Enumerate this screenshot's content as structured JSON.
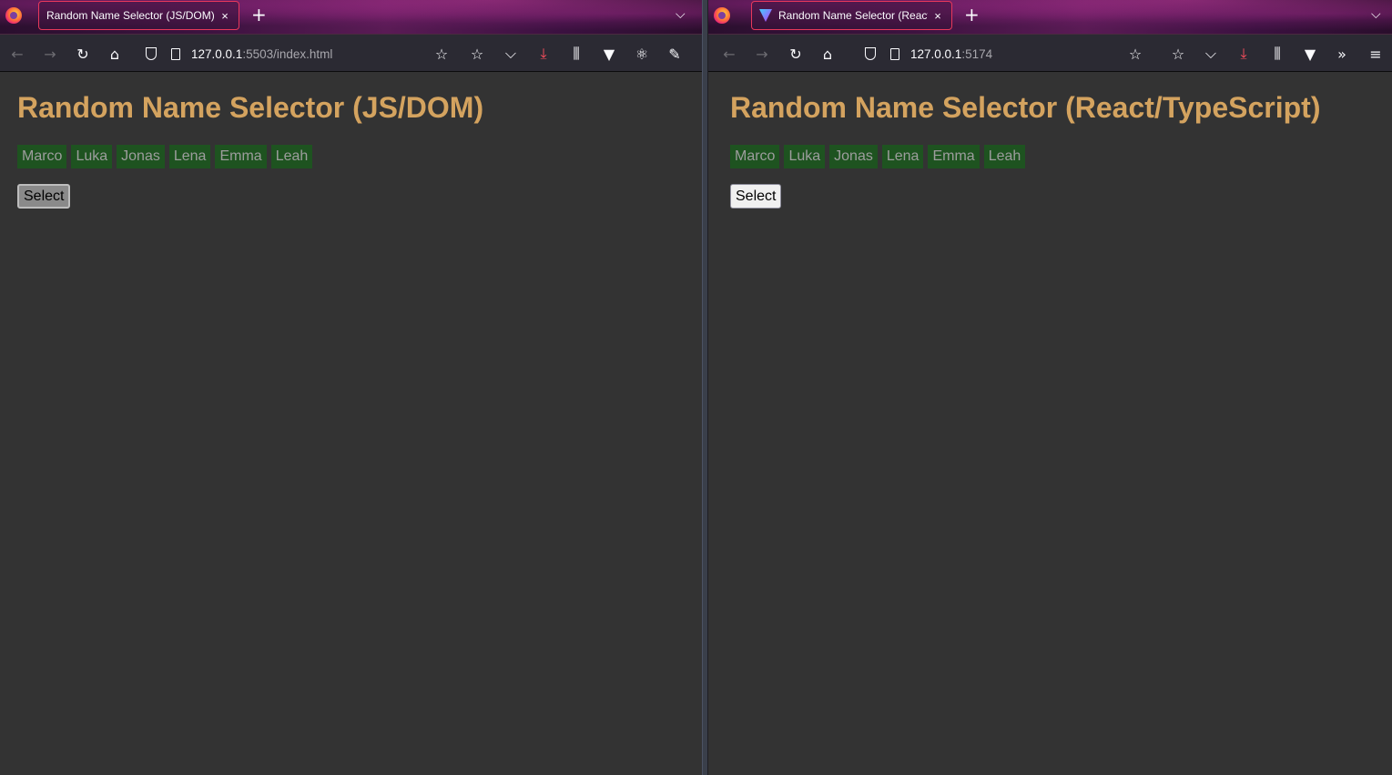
{
  "left": {
    "tab_title": "Random Name Selector (JS/DOM)",
    "url_host": "127.0.0.1",
    "url_path": ":5503/index.html",
    "page_title": "Random Name Selector (JS/DOM)",
    "names": [
      "Marco",
      "Luka",
      "Jonas",
      "Lena",
      "Emma",
      "Leah"
    ],
    "button_label": "Select"
  },
  "right": {
    "tab_title": "Random Name Selector (React/",
    "url_host": "127.0.0.1",
    "url_path": ":5174",
    "page_title": "Random Name Selector (React/TypeScript)",
    "names": [
      "Marco",
      "Luka",
      "Jonas",
      "Lena",
      "Emma",
      "Leah"
    ],
    "button_label": "Select"
  },
  "glyphs": {
    "close": "×",
    "new_tab": "+",
    "chevron": "⌵",
    "back": "←",
    "forward": "→",
    "reload": "↻",
    "home": "⌂",
    "star": "☆",
    "download": "⤓",
    "library": "⫼",
    "vue": "▼",
    "react": "⚛",
    "pen": "✎",
    "overflow": "»",
    "menu": "≡"
  },
  "colors": {
    "accent_title": "#d4a35f",
    "chip_bg": "#1e5320",
    "tab_border": "#e8385b",
    "download_icon": "#ff4f5e"
  }
}
